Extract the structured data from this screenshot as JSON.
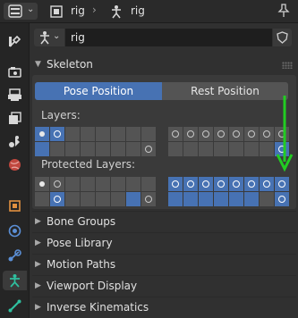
{
  "header": {
    "object_name": "rig",
    "armature_name": "rig"
  },
  "datablock": {
    "name": "rig"
  },
  "skeleton_panel": {
    "title": "Skeleton",
    "pose_position_label": "Pose Position",
    "rest_position_label": "Rest Position",
    "layers_label": "Layers:",
    "protected_layers_label": "Protected Layers:"
  },
  "collapsed_panels": [
    {
      "title": "Bone Groups"
    },
    {
      "title": "Pose Library"
    },
    {
      "title": "Motion Paths"
    },
    {
      "title": "Viewport Display"
    },
    {
      "title": "Inverse Kinematics"
    }
  ],
  "colors": {
    "accent": "#4772b3",
    "annotation_arrow": "#22cc22"
  }
}
